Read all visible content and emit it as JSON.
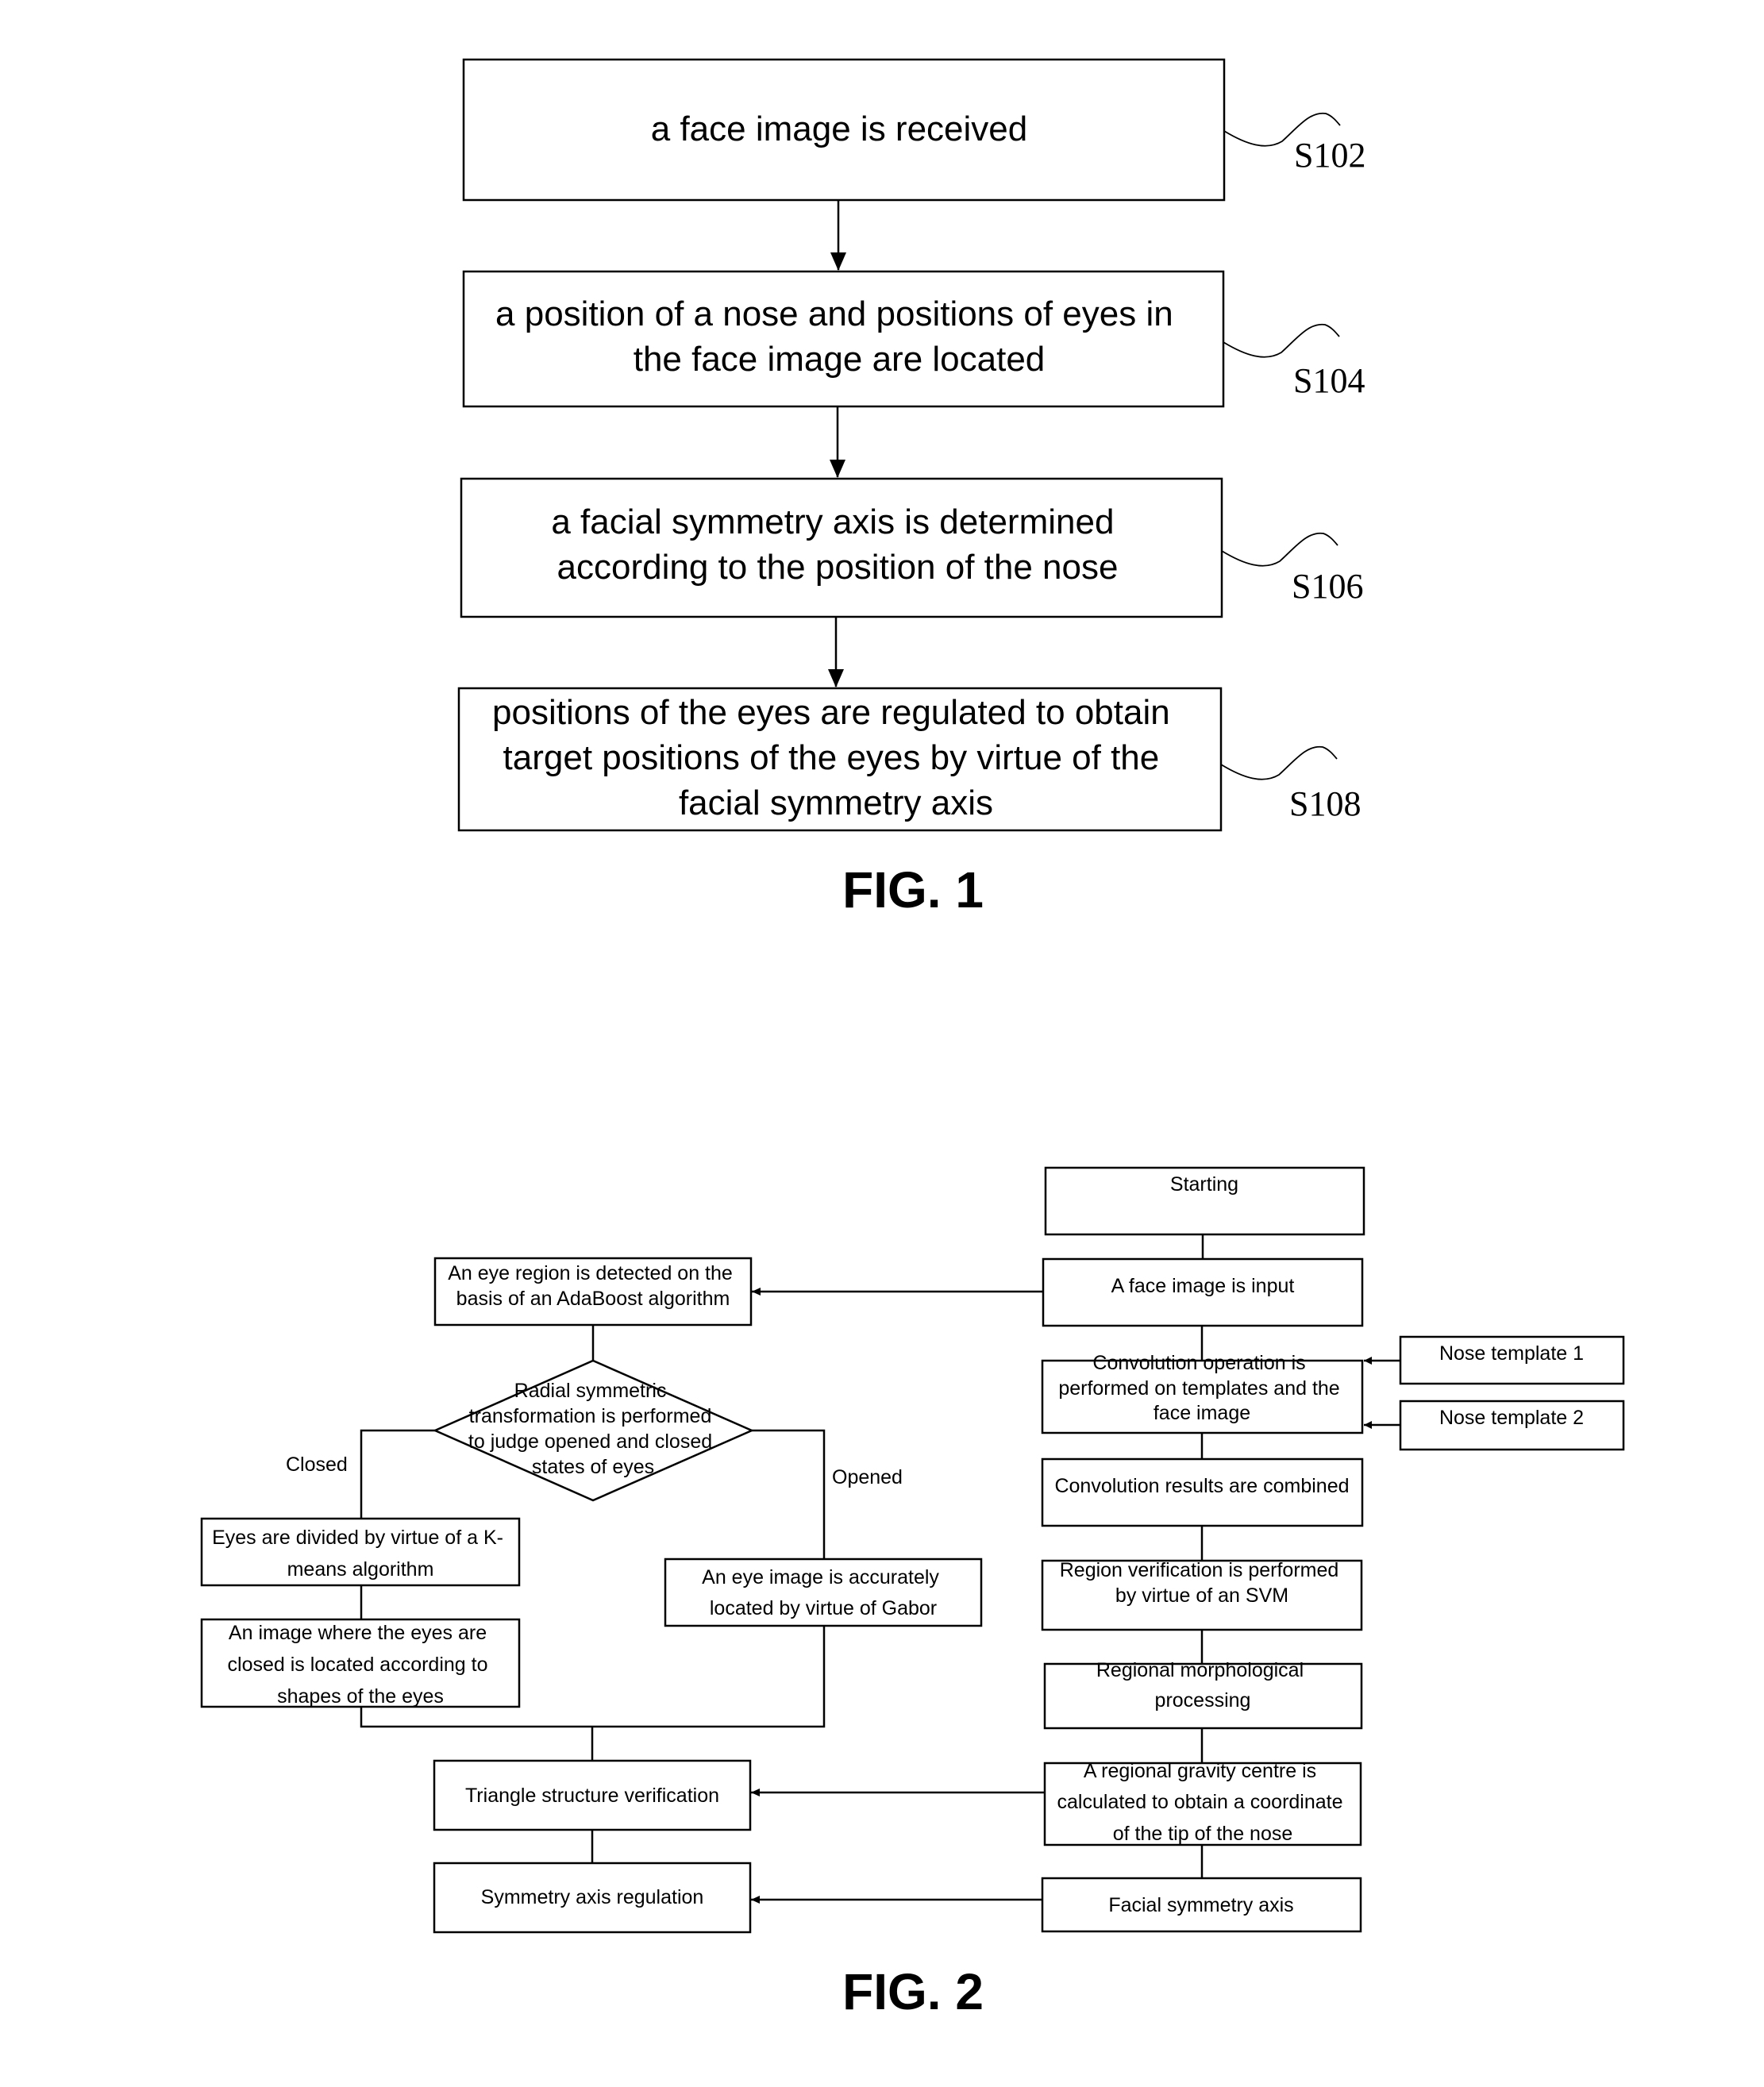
{
  "fig1": {
    "caption": "FIG. 1",
    "steps": [
      {
        "id": "S102",
        "lines": [
          "a face image is received"
        ]
      },
      {
        "id": "S104",
        "lines": [
          "a position of a nose and positions of eyes in",
          "the face image are located"
        ]
      },
      {
        "id": "S106",
        "lines": [
          "a facial symmetry axis is determined",
          "according to the position of the nose"
        ]
      },
      {
        "id": "S108",
        "lines": [
          "positions of the eyes are regulated to obtain",
          "target positions of the eyes by virtue of the",
          "facial symmetry axis"
        ]
      }
    ]
  },
  "fig2": {
    "caption": "FIG. 2",
    "nodes": {
      "starting": [
        "Starting"
      ],
      "face_input": [
        "A face image is input"
      ],
      "convolution": [
        "Convolution operation is",
        "performed on templates and the",
        "face image"
      ],
      "nose_template_1": [
        "Nose template 1"
      ],
      "nose_template_2": [
        "Nose template 2"
      ],
      "combined": [
        "Convolution results are combined"
      ],
      "svm": [
        "Region verification is performed",
        "by virtue of an SVM"
      ],
      "morphological": [
        "Regional morphological",
        "processing"
      ],
      "gravity": [
        "A regional gravity centre is",
        "calculated to obtain a coordinate",
        "of the tip of the nose"
      ],
      "facial_axis": [
        "Facial symmetry axis"
      ],
      "adaboost": [
        "An eye region is detected on the",
        "basis of an AdaBoost algorithm"
      ],
      "radial": [
        "Radial symmetric",
        "transformation is performed",
        "to judge opened and closed",
        "states of eyes"
      ],
      "kmeans": [
        "Eyes are divided by virtue of a K-",
        "means algorithm"
      ],
      "closed_located": [
        "An image where the eyes are",
        "closed is located according to",
        "shapes of the eyes"
      ],
      "gabor": [
        "An eye image is accurately",
        "located by virtue of Gabor"
      ],
      "triangle": [
        "Triangle structure verification"
      ],
      "symmetry_regulation": [
        "Symmetry axis regulation"
      ]
    },
    "labels": {
      "closed": "Closed",
      "opened": "Opened"
    }
  }
}
